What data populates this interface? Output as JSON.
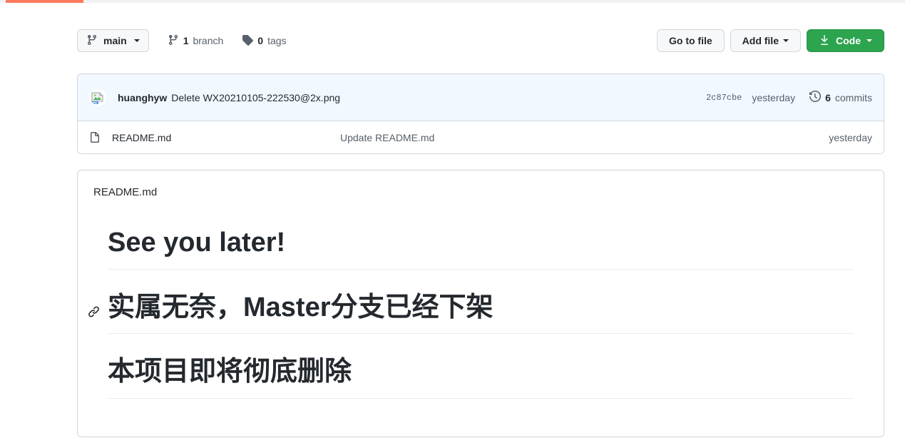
{
  "progress": {
    "name": "page-load-progress",
    "percent": 9,
    "color": "#fb7a5b"
  },
  "toolbar": {
    "branch": {
      "label": "main",
      "icon": "git-branch-icon"
    },
    "branch_count": {
      "count": "1",
      "label": "branch",
      "icon": "git-branch-icon"
    },
    "tag_count": {
      "count": "0",
      "label": "tags",
      "icon": "tag-icon"
    },
    "go_to_file_label": "Go to file",
    "add_file_label": "Add file",
    "code_label": "Code",
    "code_icon": "download-icon",
    "accent_green": "#2da44e"
  },
  "latest_commit": {
    "avatar": "broken-image-avatar",
    "author": "huanghyw",
    "message": "Delete WX20210105-222530@2x.png",
    "sha": "2c87cbe",
    "time": "yesterday",
    "commits_count": "6",
    "commits_label": "commits",
    "history_icon": "history-clock-icon",
    "row_background": "#f1f8ff"
  },
  "files": [
    {
      "icon": "file-icon",
      "name": "README.md",
      "commit_message": "Update README.md",
      "time": "yesterday"
    }
  ],
  "readme": {
    "title": "README.md",
    "headings": [
      {
        "text": "See you later!",
        "anchor": false
      },
      {
        "text": "实属无奈，Master分支已经下架",
        "anchor": true,
        "anchor_icon": "link-anchor-icon"
      },
      {
        "text": "本项目即将彻底删除",
        "anchor": false
      }
    ]
  }
}
